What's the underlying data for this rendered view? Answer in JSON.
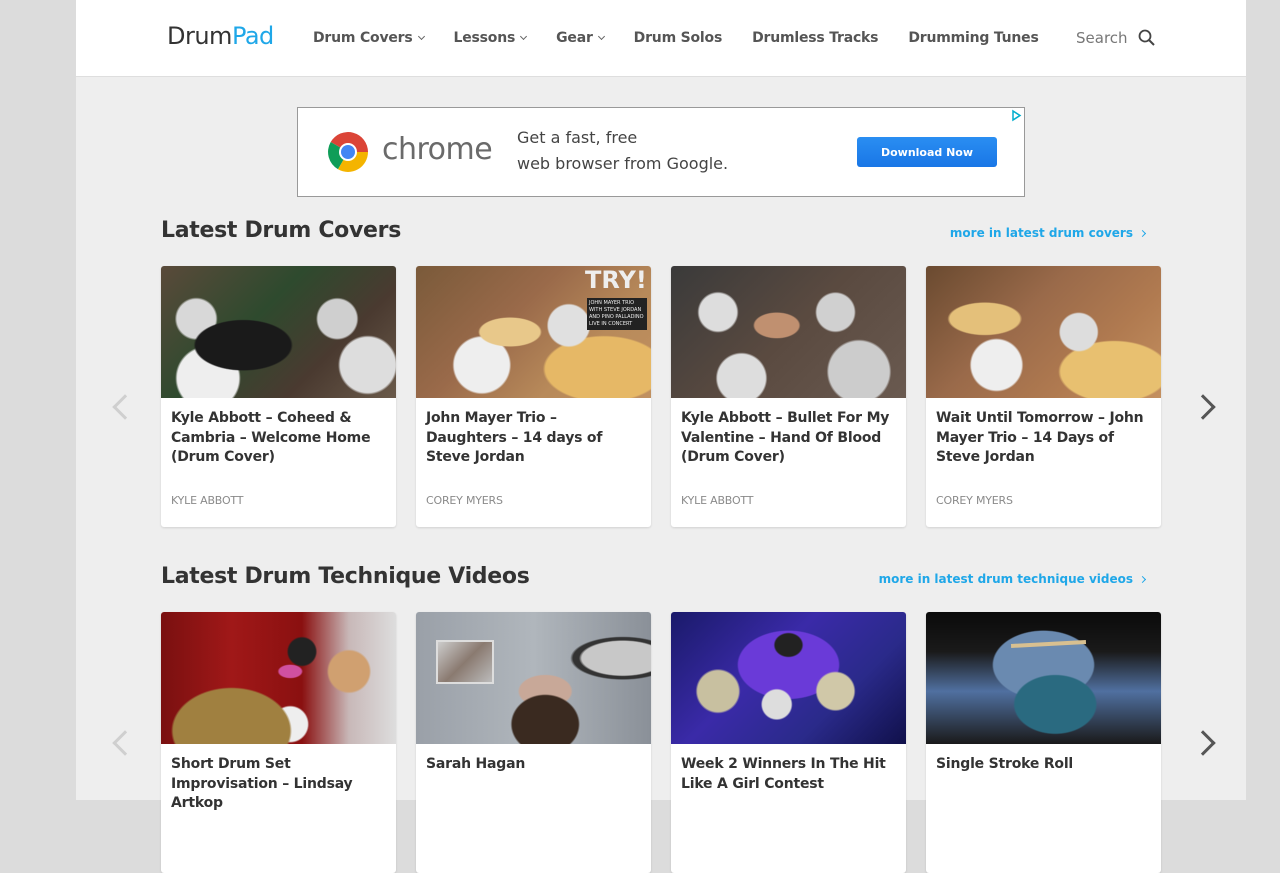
{
  "header": {
    "logo": {
      "part1": "Drum",
      "part2": "Pad"
    },
    "nav": [
      {
        "label": "Drum Covers",
        "dropdown": true
      },
      {
        "label": "Lessons",
        "dropdown": true
      },
      {
        "label": "Gear",
        "dropdown": true
      },
      {
        "label": "Drum Solos",
        "dropdown": false
      },
      {
        "label": "Drumless Tracks",
        "dropdown": false
      },
      {
        "label": "Drumming Tunes",
        "dropdown": false
      }
    ],
    "search": {
      "label": "Search",
      "icon": "search-icon"
    }
  },
  "ad": {
    "brand": "chrome",
    "line1": "Get a fast, free",
    "line2": "web browser from Google.",
    "cta": "Download Now",
    "adchoices_icon": "adchoices-icon"
  },
  "sections": [
    {
      "title": "Latest Drum Covers",
      "more_link": "more in latest drum covers",
      "cards": [
        {
          "title": "Kyle Abbott – Coheed & Cambria – Welcome Home (Drum Cover)",
          "author": "Kyle Abbott"
        },
        {
          "title": "John Mayer Trio – Daughters – 14 days of Steve Jordan",
          "author": "Corey Myers",
          "thumb_text": "TRY!",
          "thumb_subtext": "JOHN MAYER TRIO WITH STEVE JORDAN AND PINO PALLADINO LIVE IN CONCERT"
        },
        {
          "title": "Kyle Abbott – Bullet For My Valentine – Hand Of Blood (Drum Cover)",
          "author": "Kyle Abbott"
        },
        {
          "title": "Wait Until Tomorrow – John Mayer Trio – 14 Days of Steve Jordan",
          "author": "Corey Myers"
        }
      ]
    },
    {
      "title": "Latest Drum Technique Videos",
      "more_link": "more in latest drum technique videos",
      "cards": [
        {
          "title": "Short Drum Set Improvisation – Lindsay Artkop"
        },
        {
          "title": "Sarah Hagan"
        },
        {
          "title": "Week 2 Winners In The Hit Like A Girl Contest"
        },
        {
          "title": "Single Stroke Roll"
        }
      ]
    }
  ],
  "colors": {
    "brand_blue": "#1fa7e8",
    "text_dark": "#333333",
    "page_bg": "#eeeeee",
    "cta_blue": "#1976e6"
  }
}
